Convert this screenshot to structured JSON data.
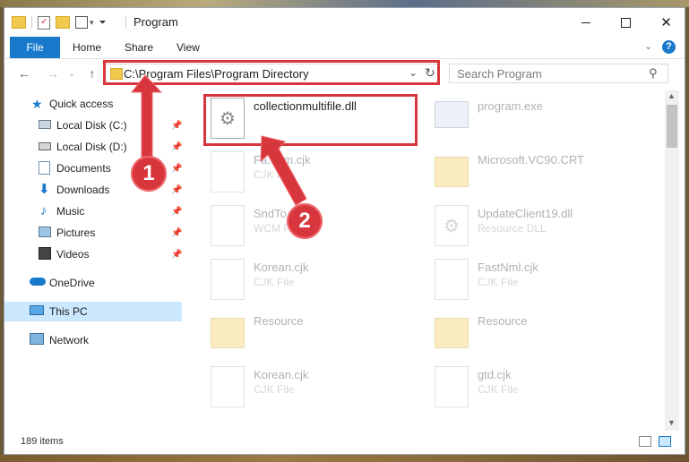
{
  "window": {
    "title": "Program"
  },
  "ribbon": {
    "tabs": [
      "File",
      "Home",
      "Share",
      "View"
    ]
  },
  "address": {
    "path": "C:\\Program Files\\Program Directory"
  },
  "search": {
    "placeholder": "Search Program"
  },
  "sidebar": {
    "items": [
      {
        "label": "Quick access",
        "icon": "star-icon",
        "pinned": false
      },
      {
        "label": "Local Disk (C:)",
        "icon": "drive-icon",
        "pinned": true
      },
      {
        "label": "Local Disk (D:)",
        "icon": "drive-icon",
        "pinned": true
      },
      {
        "label": "Documents",
        "icon": "documents-icon",
        "pinned": true
      },
      {
        "label": "Downloads",
        "icon": "download-arrow-icon",
        "pinned": true
      },
      {
        "label": "Music",
        "icon": "music-note-icon",
        "pinned": true
      },
      {
        "label": "Pictures",
        "icon": "pictures-icon",
        "pinned": true
      },
      {
        "label": "Videos",
        "icon": "film-icon",
        "pinned": true
      },
      {
        "label": "OneDrive",
        "icon": "cloud-icon",
        "pinned": false
      },
      {
        "label": "This PC",
        "icon": "monitor-icon",
        "pinned": false,
        "selected": true
      },
      {
        "label": "Network",
        "icon": "network-icon",
        "pinned": false
      }
    ]
  },
  "files": [
    {
      "name": "collectionmultifile.dll",
      "type": "",
      "icon": "dll-gear-icon",
      "highlighted": true
    },
    {
      "name": "program.exe",
      "type": "",
      "icon": "exe-icon"
    },
    {
      "name": "Fa...em.cjk",
      "type": "CJK File",
      "icon": "blank-file-icon"
    },
    {
      "name": "Microsoft.VC90.CRT",
      "type": "",
      "icon": "folder-icon"
    },
    {
      "name": "SndTo...ecm",
      "type": "WCM F...",
      "icon": "blank-file-icon"
    },
    {
      "name": "UpdateClient19.dll",
      "type": "Resource DLL",
      "icon": "dll-gear-icon"
    },
    {
      "name": "Korean.cjk",
      "type": "CJK File",
      "icon": "blank-file-icon"
    },
    {
      "name": "FastNml.cjk",
      "type": "CJK File",
      "icon": "blank-file-icon"
    },
    {
      "name": "Resource",
      "type": "",
      "icon": "folder-icon"
    },
    {
      "name": "Resource",
      "type": "",
      "icon": "folder-icon"
    },
    {
      "name": "Korean.cjk",
      "type": "CJK File",
      "icon": "blank-file-icon"
    },
    {
      "name": "gtd.cjk",
      "type": "CJK File",
      "icon": "blank-file-icon"
    }
  ],
  "status": {
    "items_text": "189 items"
  },
  "annotations": {
    "step1": "1",
    "step2": "2"
  },
  "colors": {
    "accent": "#1979ca",
    "highlight": "#d8363d",
    "selection": "#cce8ff"
  }
}
